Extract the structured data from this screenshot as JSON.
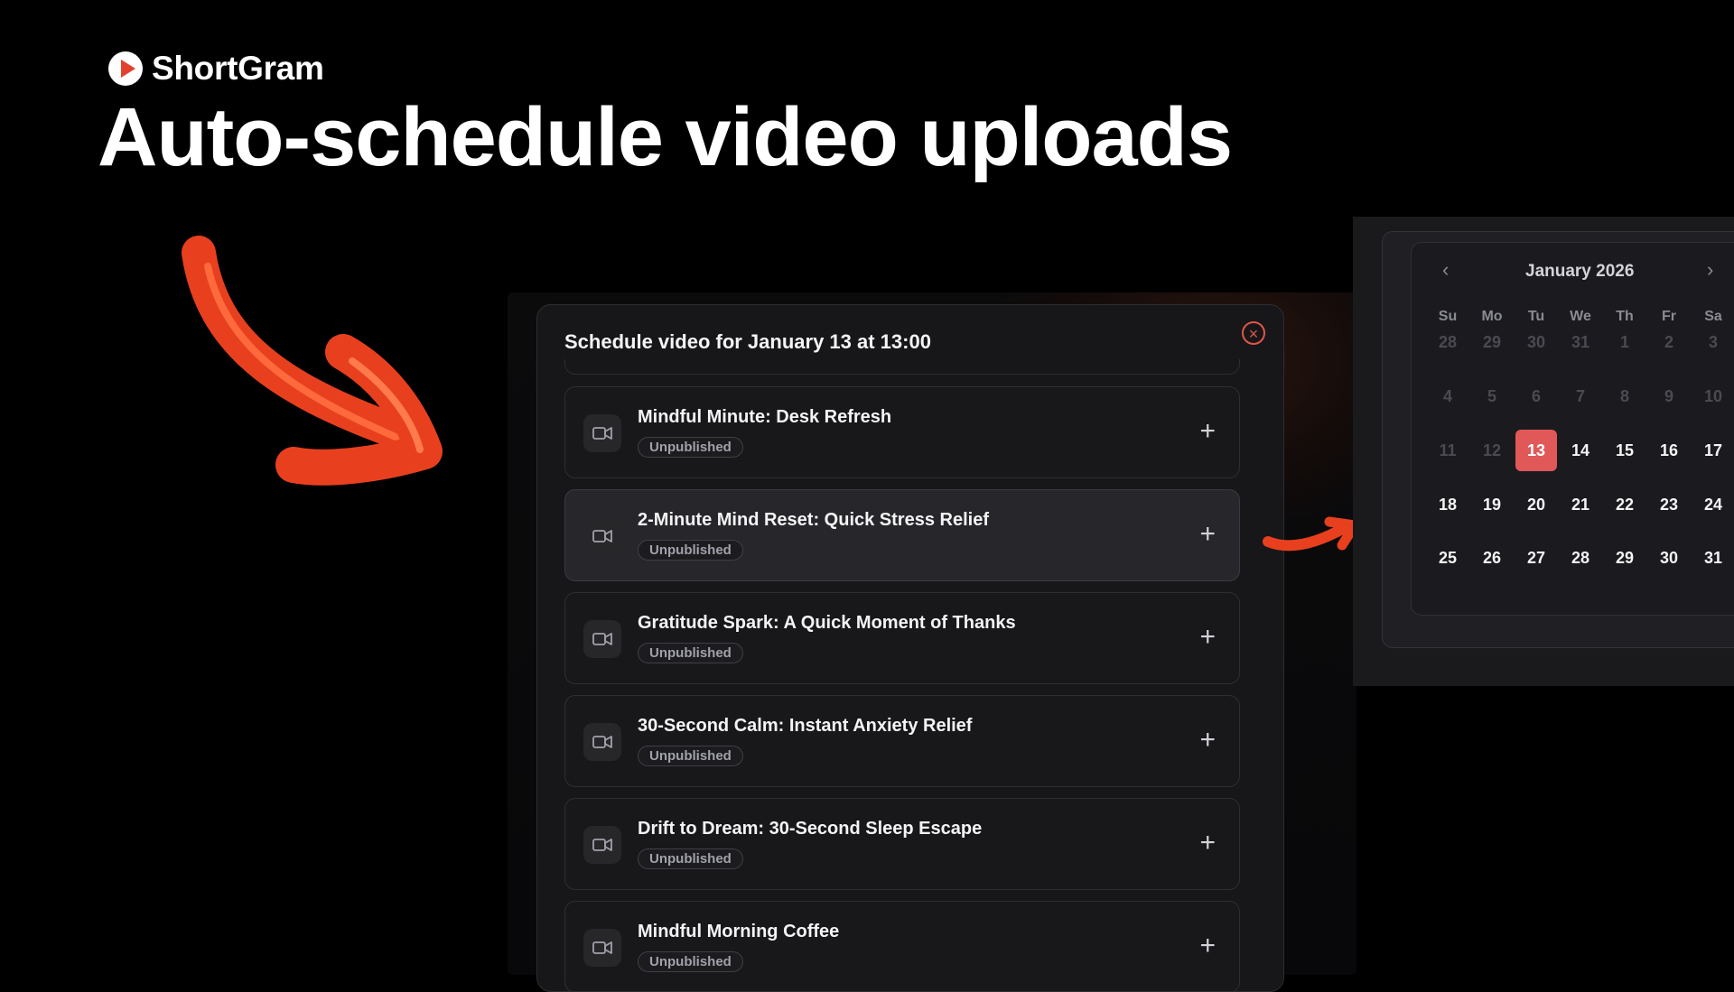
{
  "brand": {
    "name": "ShortGram"
  },
  "headline": "Auto-schedule video uploads",
  "modal": {
    "title": "Schedule video for January 13 at 13:00",
    "videos": [
      {
        "title": "Mindful Minute: Desk Refresh",
        "status": "Unpublished"
      },
      {
        "title": "2-Minute Mind Reset: Quick Stress Relief",
        "status": "Unpublished"
      },
      {
        "title": "Gratitude Spark: A Quick Moment of Thanks",
        "status": "Unpublished"
      },
      {
        "title": "30-Second Calm: Instant Anxiety Relief",
        "status": "Unpublished"
      },
      {
        "title": "Drift to Dream: 30-Second Sleep Escape",
        "status": "Unpublished"
      },
      {
        "title": "Mindful Morning Coffee",
        "status": "Unpublished"
      }
    ]
  },
  "calendar": {
    "month": "January 2026",
    "weekdays": [
      "Su",
      "Mo",
      "Tu",
      "We",
      "Th",
      "Fr",
      "Sa"
    ],
    "weeks": [
      [
        "28",
        "29",
        "30",
        "31",
        "1",
        "2",
        "3"
      ],
      [
        "4",
        "5",
        "6",
        "7",
        "8",
        "9",
        "10"
      ],
      [
        "11",
        "12",
        "13",
        "14",
        "15",
        "16",
        "17"
      ],
      [
        "18",
        "19",
        "20",
        "21",
        "22",
        "23",
        "24"
      ],
      [
        "25",
        "26",
        "27",
        "28",
        "29",
        "30",
        "31"
      ]
    ],
    "selected": "13"
  },
  "colors": {
    "accent": "#e2412f",
    "selected_day": "#e05858",
    "background": "#000000"
  },
  "icons": {
    "logo": "play-logo-icon",
    "video": "video-camera-icon",
    "add": "plus-icon",
    "close": "close-icon",
    "prev": "chevron-left-icon",
    "next": "chevron-right-icon"
  }
}
